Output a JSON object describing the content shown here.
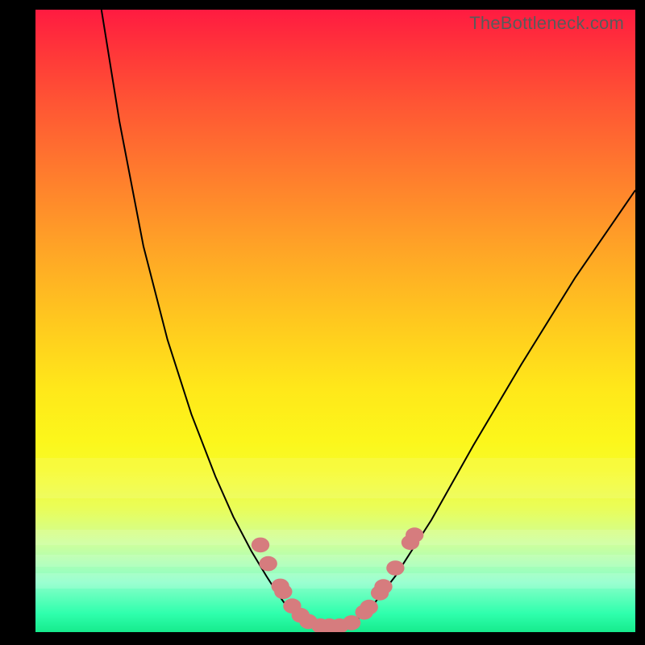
{
  "watermark": "TheBottleneck.com",
  "colors": {
    "frame_bg": "#000000",
    "gradient_top": "#ff1b41",
    "gradient_bottom": "#16eb8d",
    "curve_stroke": "#000000",
    "marker_fill": "#d67c7e"
  },
  "chart_data": {
    "type": "line",
    "title": "",
    "xlabel": "",
    "ylabel": "",
    "xlim": [
      0,
      100
    ],
    "ylim": [
      0,
      100
    ],
    "grid": false,
    "legend": false,
    "series": [
      {
        "name": "left-branch",
        "x": [
          11,
          14,
          18,
          22,
          26,
          30,
          33,
          36,
          38.5,
          40.5,
          42,
          43.5,
          45
        ],
        "y": [
          100,
          82,
          62,
          47,
          35,
          25,
          18.5,
          13,
          9,
          6,
          4,
          2.5,
          1.5
        ]
      },
      {
        "name": "valley-floor",
        "x": [
          45,
          47,
          49,
          51,
          53
        ],
        "y": [
          1.5,
          1.0,
          1.0,
          1.0,
          1.5
        ]
      },
      {
        "name": "right-branch",
        "x": [
          53,
          56,
          60,
          66,
          73,
          81,
          90,
          100
        ],
        "y": [
          1.5,
          4,
          9,
          18,
          30,
          43,
          57,
          71
        ]
      }
    ],
    "markers": {
      "name": "data-markers",
      "points": [
        {
          "x": 37.5,
          "y": 14.0
        },
        {
          "x": 38.8,
          "y": 11.0
        },
        {
          "x": 40.8,
          "y": 7.4
        },
        {
          "x": 41.3,
          "y": 6.5
        },
        {
          "x": 42.8,
          "y": 4.2
        },
        {
          "x": 44.2,
          "y": 2.7
        },
        {
          "x": 45.5,
          "y": 1.7
        },
        {
          "x": 47.5,
          "y": 1.0
        },
        {
          "x": 49.0,
          "y": 1.0
        },
        {
          "x": 50.7,
          "y": 1.0
        },
        {
          "x": 52.7,
          "y": 1.5
        },
        {
          "x": 54.8,
          "y": 3.2
        },
        {
          "x": 55.6,
          "y": 4.0
        },
        {
          "x": 57.4,
          "y": 6.3
        },
        {
          "x": 58.0,
          "y": 7.3
        },
        {
          "x": 60.0,
          "y": 10.3
        },
        {
          "x": 62.5,
          "y": 14.4
        },
        {
          "x": 63.2,
          "y": 15.6
        }
      ],
      "radius_x": 1.5,
      "radius_y": 1.2
    },
    "bands": [
      {
        "y": 21.5,
        "height": 6.5,
        "opacity": 0.11
      },
      {
        "y": 14.0,
        "height": 2.5,
        "opacity": 0.12
      },
      {
        "y": 10.5,
        "height": 2.0,
        "opacity": 0.13
      },
      {
        "y": 7.0,
        "height": 2.5,
        "opacity": 0.15
      }
    ]
  }
}
